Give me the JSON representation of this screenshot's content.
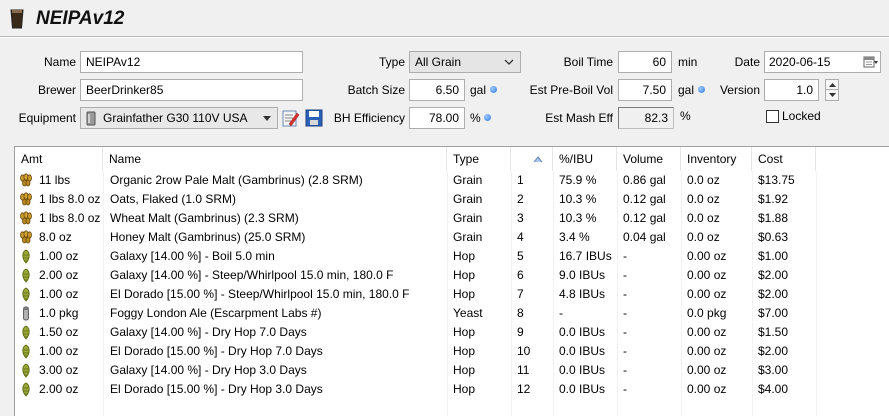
{
  "recipe": {
    "title": "NEIPAv12"
  },
  "form": {
    "name_label": "Name",
    "name_value": "NEIPAv12",
    "brewer_label": "Brewer",
    "brewer_value": "BeerDrinker85",
    "equipment_label": "Equipment",
    "equipment_value": "Grainfather G30 110V USA",
    "type_label": "Type",
    "type_value": "All Grain",
    "batch_size_label": "Batch Size",
    "batch_size_value": "6.50",
    "batch_size_unit": "gal",
    "bh_eff_label": "BH Efficiency",
    "bh_eff_value": "78.00",
    "bh_eff_unit": "%",
    "boil_time_label": "Boil Time",
    "boil_time_value": "60",
    "boil_time_unit": "min",
    "pre_boil_label": "Est Pre-Boil Vol",
    "pre_boil_value": "7.50",
    "pre_boil_unit": "gal",
    "mash_eff_label": "Est Mash Eff",
    "mash_eff_value": "82.3",
    "mash_eff_unit": "%",
    "date_label": "Date",
    "date_value": "2020-06-15",
    "version_label": "Version",
    "version_value": "1.0",
    "locked_label": "Locked",
    "locked_checked": false
  },
  "table": {
    "headers": {
      "amt": "Amt",
      "name": "Name",
      "type": "Type",
      "order": "",
      "ibu": "%/IBU",
      "volume": "Volume",
      "inventory": "Inventory",
      "cost": "Cost"
    },
    "rows": [
      {
        "icon": "grain-icon",
        "amt": "11 lbs",
        "name": "Organic 2row Pale Malt (Gambrinus) (2.8 SRM)",
        "type": "Grain",
        "order": "1",
        "ibu": "75.9 %",
        "volume": "0.86 gal",
        "inventory": "0.0 oz",
        "cost": "$13.75"
      },
      {
        "icon": "grain-icon",
        "amt": "1 lbs 8.0 oz",
        "name": "Oats, Flaked (1.0 SRM)",
        "type": "Grain",
        "order": "2",
        "ibu": "10.3 %",
        "volume": "0.12 gal",
        "inventory": "0.0 oz",
        "cost": "$1.92"
      },
      {
        "icon": "grain-icon",
        "amt": "1 lbs 8.0 oz",
        "name": "Wheat Malt (Gambrinus) (2.3 SRM)",
        "type": "Grain",
        "order": "3",
        "ibu": "10.3 %",
        "volume": "0.12 gal",
        "inventory": "0.0 oz",
        "cost": "$1.88"
      },
      {
        "icon": "grain-icon",
        "amt": "8.0 oz",
        "name": "Honey Malt (Gambrinus) (25.0 SRM)",
        "type": "Grain",
        "order": "4",
        "ibu": "3.4 %",
        "volume": "0.04 gal",
        "inventory": "0.0 oz",
        "cost": "$0.63"
      },
      {
        "icon": "hop-icon",
        "amt": "1.00 oz",
        "name": "Galaxy [14.00 %] - Boil 5.0 min",
        "type": "Hop",
        "order": "5",
        "ibu": "16.7 IBUs",
        "volume": "-",
        "inventory": "0.00 oz",
        "cost": "$1.00"
      },
      {
        "icon": "hop-icon",
        "amt": "2.00 oz",
        "name": "Galaxy [14.00 %] - Steep/Whirlpool  15.0 min, 180.0 F",
        "type": "Hop",
        "order": "6",
        "ibu": "9.0 IBUs",
        "volume": "-",
        "inventory": "0.00 oz",
        "cost": "$2.00"
      },
      {
        "icon": "hop-icon",
        "amt": "1.00 oz",
        "name": "El Dorado [15.00 %] - Steep/Whirlpool  15.0 min, 180.0 F",
        "type": "Hop",
        "order": "7",
        "ibu": "4.8 IBUs",
        "volume": "-",
        "inventory": "0.00 oz",
        "cost": "$2.00"
      },
      {
        "icon": "yeast-icon",
        "amt": "1.0 pkg",
        "name": "Foggy London Ale (Escarpment Labs #)",
        "type": "Yeast",
        "order": "8",
        "ibu": "-",
        "volume": "-",
        "inventory": "0.0 pkg",
        "cost": "$7.00"
      },
      {
        "icon": "hop-icon",
        "amt": "1.50 oz",
        "name": "Galaxy [14.00 %] - Dry Hop 7.0 Days",
        "type": "Hop",
        "order": "9",
        "ibu": "0.0 IBUs",
        "volume": "-",
        "inventory": "0.00 oz",
        "cost": "$1.50"
      },
      {
        "icon": "hop-icon",
        "amt": "1.00 oz",
        "name": "El Dorado [15.00 %] - Dry Hop 7.0 Days",
        "type": "Hop",
        "order": "10",
        "ibu": "0.0 IBUs",
        "volume": "-",
        "inventory": "0.00 oz",
        "cost": "$2.00"
      },
      {
        "icon": "hop-icon",
        "amt": "3.00 oz",
        "name": "Galaxy [14.00 %] - Dry Hop 3.0 Days",
        "type": "Hop",
        "order": "11",
        "ibu": "0.0 IBUs",
        "volume": "-",
        "inventory": "0.00 oz",
        "cost": "$3.00"
      },
      {
        "icon": "hop-icon",
        "amt": "2.00 oz",
        "name": "El Dorado [15.00 %] - Dry Hop 3.0 Days",
        "type": "Hop",
        "order": "12",
        "ibu": "0.0 IBUs",
        "volume": "-",
        "inventory": "0.00 oz",
        "cost": "$4.00"
      }
    ]
  },
  "colors": {
    "accent": "#2f7be0",
    "grain": "#8a6a1a",
    "hop": "#7a8a1a",
    "yeast": "#8a8a8a"
  }
}
